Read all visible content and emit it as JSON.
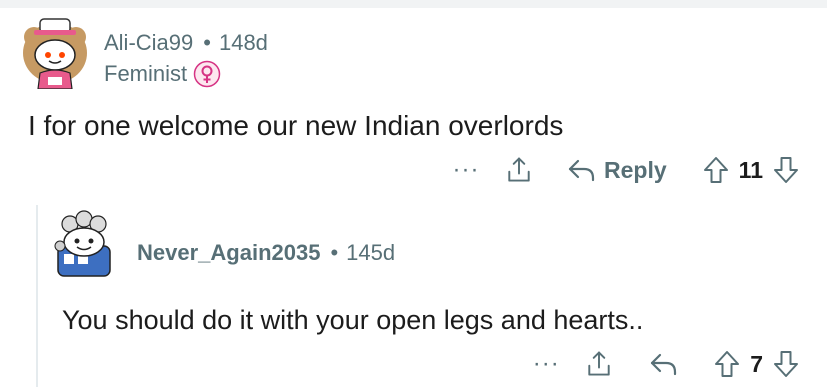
{
  "comment1": {
    "author": "Ali-Cia99",
    "separator": "•",
    "age": "148d",
    "flair": "Feminist",
    "text": "I for one welcome our new Indian overlords",
    "actions": {
      "more_label": "···",
      "reply_label": "Reply",
      "vote_count": "11"
    }
  },
  "comment2": {
    "author": "Never_Again2035",
    "separator": "•",
    "age": "145d",
    "text": "You should do it with your open legs and hearts..",
    "actions": {
      "more_label": "···",
      "vote_count": "7"
    }
  },
  "colors": {
    "meta_text": "#576f76",
    "body_text": "#1c1c1c",
    "thread_line": "#e5ebee",
    "flair_accent": "#d63384"
  },
  "icons": [
    "avatar",
    "feminist-symbol-icon",
    "more-icon",
    "share-icon",
    "reply-icon",
    "upvote-icon",
    "downvote-icon"
  ]
}
